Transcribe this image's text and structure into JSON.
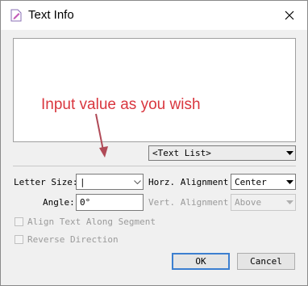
{
  "window": {
    "title": "Text Info",
    "title_icon": "document-edit-icon",
    "close_icon": "close-icon"
  },
  "annotation": {
    "text": "Input value as you wish",
    "color": "#d9363e"
  },
  "text_list": {
    "selected": "<Text List>"
  },
  "letter_size": {
    "label": "Letter Size:",
    "value": "|"
  },
  "angle": {
    "label": "Angle:",
    "value": "0°"
  },
  "horz_alignment": {
    "label": "Horz. Alignment:",
    "selected": "Center"
  },
  "vert_alignment": {
    "label": "Vert. Alignment:",
    "selected": "Above"
  },
  "options": {
    "align_along_segment": "Align Text Along Segment",
    "reverse_direction": "Reverse Direction"
  },
  "buttons": {
    "ok": "OK",
    "cancel": "Cancel"
  },
  "colors": {
    "accent": "#3c7fd0",
    "annotation": "#d9363e"
  }
}
